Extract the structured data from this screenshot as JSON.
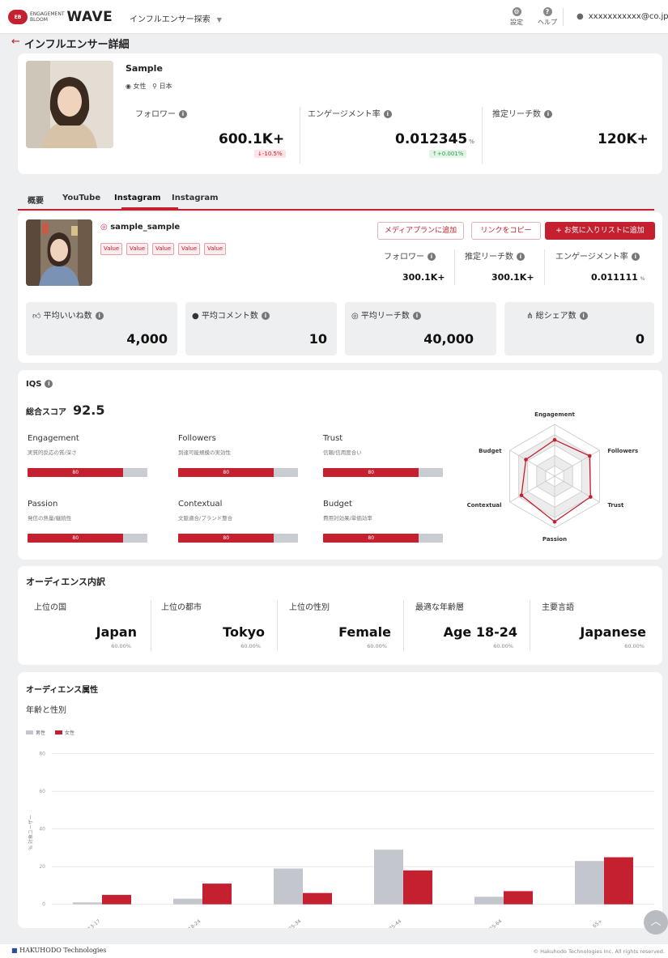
{
  "header": {
    "logo_badge": "EB",
    "logo_small_1": "ENGAGEMENT",
    "logo_small_2": "BLOOM",
    "logo_main": "WAVE",
    "nav_menu": "インフルエンサー探索",
    "settings": "設定",
    "help": "ヘルプ",
    "user_email": "xxxxxxxxxxx@co.jp"
  },
  "page": {
    "title": "インフルエンサー詳細"
  },
  "profile": {
    "name": "Sample",
    "gender": "女性",
    "country": "日本",
    "metrics": [
      {
        "label": "フォロワー",
        "value": "600.1K+",
        "change": "-10.5%"
      },
      {
        "label": "エンゲージメント率",
        "value": "0.012345",
        "unit": "%",
        "change": "+0.001%"
      },
      {
        "label": "推定リーチ数",
        "value": "120K+"
      }
    ]
  },
  "tabs": [
    "概要",
    "YouTube",
    "Instagram",
    "Instagram"
  ],
  "account": {
    "handle": "sample_sample",
    "tags": [
      "Value",
      "Value",
      "Value",
      "Value",
      "Value"
    ],
    "buttons": {
      "media": "メディアプランに追加",
      "copy": "リンクをコピー",
      "fav": "お気に入りリストに追加"
    },
    "metrics": [
      {
        "label": "フォロワー",
        "value": "300.1K+"
      },
      {
        "label": "推定リーチ数",
        "value": "300.1K+"
      },
      {
        "label": "エンゲージメント率",
        "value": "0.011111",
        "unit": "%"
      }
    ],
    "stats": [
      {
        "label": "平均いいね数",
        "value": "4,000"
      },
      {
        "label": "平均コメント数",
        "value": "10"
      },
      {
        "label": "平均リーチ数",
        "value": "40,000"
      },
      {
        "label": "総シェア数",
        "value": "0"
      }
    ]
  },
  "iqs": {
    "title": "IQS",
    "score_label": "総合スコア",
    "score": "92.5",
    "metrics": [
      {
        "name": "Engagement",
        "desc": "実質的反応の質/深さ",
        "value": 80,
        "label": "80"
      },
      {
        "name": "Followers",
        "desc": "到達可能規模の実効性",
        "value": 80,
        "label": "80"
      },
      {
        "name": "Trust",
        "desc": "信頼/信用度合い",
        "value": 80,
        "label": "80"
      },
      {
        "name": "Passion",
        "desc": "発信の熱量/継続性",
        "value": 80,
        "label": "80"
      },
      {
        "name": "Contextual",
        "desc": "文脈適合/ブランド整合",
        "value": 80,
        "label": "80"
      },
      {
        "name": "Budget",
        "desc": "費用対効果/単価効率",
        "value": 80,
        "label": "80"
      }
    ],
    "radar": {
      "axes": [
        "Engagement",
        "Followers",
        "Trust",
        "Passion",
        "Contextual",
        "Budget"
      ],
      "values": [
        70,
        78,
        80,
        88,
        74,
        64
      ]
    }
  },
  "audience": {
    "title": "オーディエンス内訳",
    "items": [
      {
        "label": "上位の国",
        "value": "Japan",
        "pct": "60.00%"
      },
      {
        "label": "上位の都市",
        "value": "Tokyo",
        "pct": "60.00%"
      },
      {
        "label": "上位の性別",
        "value": "Female",
        "pct": "60.00%"
      },
      {
        "label": "最適な年齢層",
        "value": "Age 18-24",
        "pct": "60.00%"
      },
      {
        "label": "主要言語",
        "value": "Japanese",
        "pct": "60.00%"
      }
    ]
  },
  "attributes": {
    "title": "オーディエンス属性",
    "subtitle": "年齢と性別"
  },
  "chart_data": {
    "type": "bar",
    "categories": [
      "13-17",
      "18-24",
      "25-34",
      "35-44",
      "55-64",
      "65+"
    ],
    "series": [
      {
        "name": "男性",
        "values": [
          1,
          3,
          19,
          29,
          4,
          23
        ],
        "color": "#c3c6cc"
      },
      {
        "name": "女性",
        "values": [
          5,
          11,
          6,
          18,
          7,
          25
        ],
        "color": "#c4202f"
      }
    ],
    "ylabel": "% 対象ユーザー",
    "yticks": [
      0,
      20,
      40,
      60,
      80
    ],
    "ylim": [
      -4,
      82
    ],
    "legend": "top-left",
    "grid": true
  },
  "footer": {
    "company": "HAKUHODO Technologies",
    "copyright": "© Hakuhodo Technologies Inc. All rights reserved."
  }
}
